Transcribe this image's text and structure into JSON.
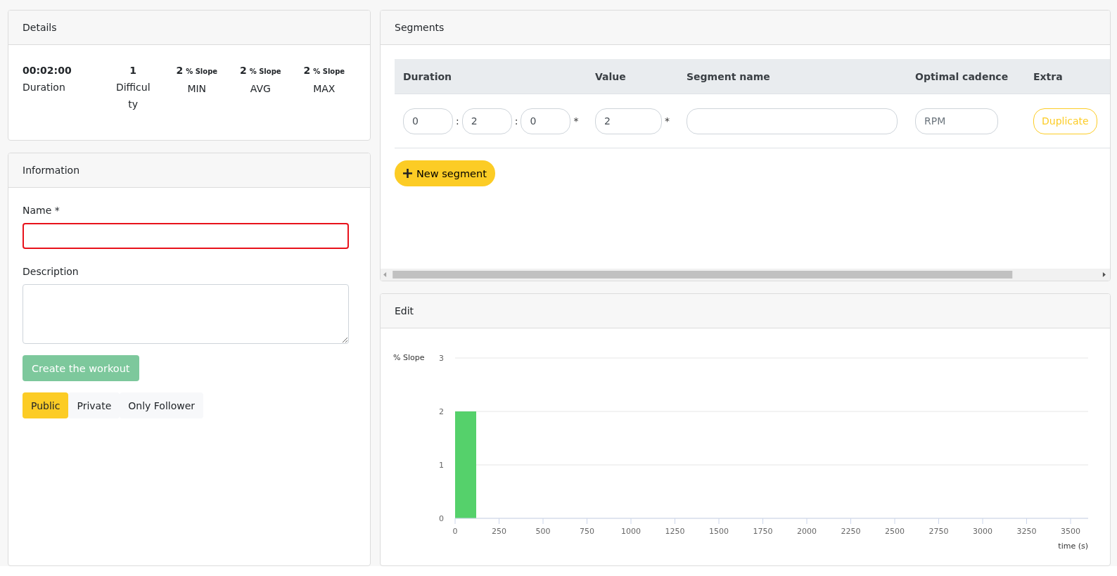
{
  "details": {
    "title": "Details",
    "stats": [
      {
        "value": "00:02:00",
        "label": "Duration"
      },
      {
        "value": "1",
        "label": "Difficulty"
      },
      {
        "value": "2",
        "unit": "% Slope",
        "label": "MIN"
      },
      {
        "value": "2",
        "unit": "% Slope",
        "label": "AVG"
      },
      {
        "value": "2",
        "unit": "% Slope",
        "label": "MAX"
      }
    ]
  },
  "information": {
    "title": "Information",
    "name_label": "Name *",
    "name_invalid": true,
    "description_label": "Description",
    "create_button": "Create the workout",
    "create_disabled": true,
    "visibility": [
      {
        "label": "Public",
        "selected": true
      },
      {
        "label": "Private",
        "selected": false
      },
      {
        "label": "Only Follower",
        "selected": false
      }
    ]
  },
  "segments": {
    "title": "Segments",
    "columns": [
      "Duration",
      "Value",
      "Segment name",
      "Optimal cadence",
      "Extra"
    ],
    "rows": [
      {
        "hours": "0",
        "separator_1": ":",
        "minutes": "2",
        "separator_2": ":",
        "seconds": "0",
        "duration_mark": "*",
        "value": "2",
        "value_mark": "*",
        "cadence_placeholder": "RPM",
        "extra_button": "Duplicate"
      }
    ],
    "new_button": "New segment"
  },
  "edit": {
    "title": "Edit",
    "chart_data": {
      "type": "bar",
      "x": [
        60
      ],
      "values": [
        2
      ],
      "xlabel": "time (s)",
      "ylabel": "% Slope",
      "xlim": [
        0,
        3600
      ],
      "ylim": [
        0,
        3
      ],
      "xticks": [
        0,
        250,
        500,
        750,
        1000,
        1250,
        1500,
        1750,
        2000,
        2250,
        2500,
        2750,
        3000,
        3250,
        3500
      ],
      "yticks": [
        0,
        1,
        2,
        3
      ]
    }
  }
}
